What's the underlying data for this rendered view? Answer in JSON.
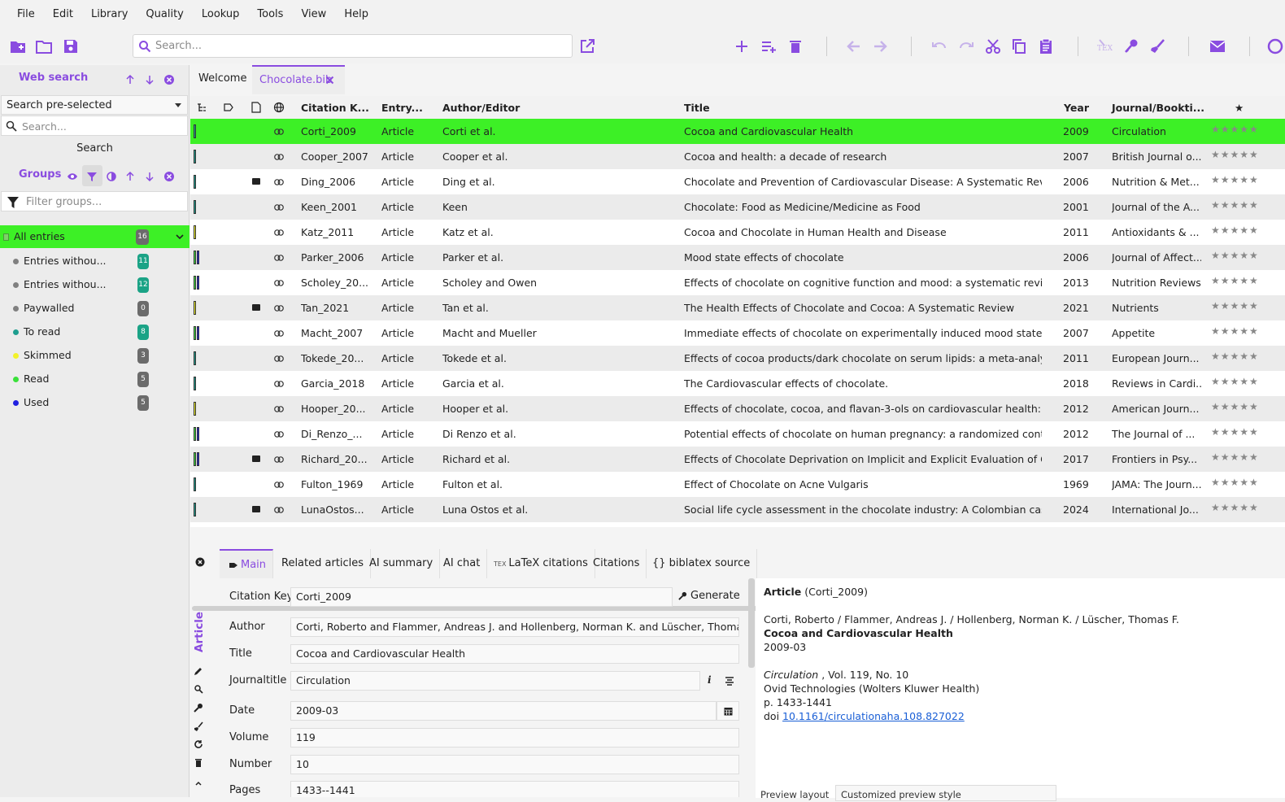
{
  "menu": [
    "File",
    "Edit",
    "Library",
    "Quality",
    "Lookup",
    "Tools",
    "View",
    "Help"
  ],
  "toolbar": {
    "search_placeholder": "Search...",
    "icons": [
      "new-library-icon",
      "open-library-icon",
      "save-icon",
      "open-external-icon",
      "add-entry-icon",
      "add-list-icon",
      "delete-icon",
      "back-icon",
      "forward-icon",
      "undo-icon",
      "redo-icon",
      "cut-icon",
      "copy-icon",
      "paste-icon",
      "tex-icon",
      "lookup-key-icon",
      "cleanup-icon",
      "email-icon"
    ]
  },
  "sidebar": {
    "web_search_title": "Web search",
    "web_search_combo": "Search pre-selected",
    "web_search_placeholder": "Search...",
    "search_button": "Search",
    "groups_title": "Groups",
    "filter_placeholder": "Filter groups...",
    "groups": [
      {
        "label": "All entries",
        "count": "16",
        "color": "#888888"
      },
      {
        "label": "Entries withou...",
        "count": "11",
        "color": "#808080"
      },
      {
        "label": "Entries withou...",
        "count": "12",
        "color": "#808080"
      },
      {
        "label": "Paywalled",
        "count": "0",
        "color": "#808080"
      },
      {
        "label": "To read",
        "count": "8",
        "color": "#1e9e8f"
      },
      {
        "label": "Skimmed",
        "count": "3",
        "color": "#f2f22a"
      },
      {
        "label": "Read",
        "count": "5",
        "color": "#3ae03a"
      },
      {
        "label": "Used",
        "count": "5",
        "color": "#2020e0"
      }
    ]
  },
  "tabs": {
    "welcome": "Welcome",
    "library": "Chocolate.bib"
  },
  "table": {
    "headers": {
      "key": "Citation K...",
      "type": "Entry...",
      "author": "Author/Editor",
      "title": "Title",
      "year": "Year",
      "journal": "Journal/Bookti...",
      "star": "★"
    },
    "stars": "★★★★★",
    "rows": [
      {
        "key": "Corti_2009",
        "type": "Article",
        "author": "Corti et al.",
        "title": "Cocoa and Cardiovascular Health",
        "year": "2009",
        "journal": "Circulation",
        "pdf": false,
        "bars": [
          "#1e9e8f"
        ]
      },
      {
        "key": "Cooper_2007",
        "type": "Article",
        "author": "Cooper et al.",
        "title": "Cocoa and health: a decade of research",
        "year": "2007",
        "journal": "British Journal o...",
        "pdf": false,
        "bars": [
          "#1e9e8f"
        ]
      },
      {
        "key": "Ding_2006",
        "type": "Article",
        "author": "Ding et al.",
        "title": "Chocolate and Prevention of Cardiovascular Disease: A Systematic Review",
        "year": "2006",
        "journal": "Nutrition & Met...",
        "pdf": true,
        "bars": [
          "#1e9e8f"
        ]
      },
      {
        "key": "Keen_2001",
        "type": "Article",
        "author": "Keen",
        "title": "Chocolate: Food as Medicine/Medicine as Food",
        "year": "2001",
        "journal": "Journal of the A...",
        "pdf": false,
        "bars": [
          "#1e9e8f"
        ]
      },
      {
        "key": "Katz_2011",
        "type": "Article",
        "author": "Katz et al.",
        "title": "Cocoa and Chocolate in Human Health and Disease",
        "year": "2011",
        "journal": "Antioxidants & ...",
        "pdf": false,
        "bars": [
          "#f2f22a"
        ]
      },
      {
        "key": "Parker_2006",
        "type": "Article",
        "author": "Parker et al.",
        "title": "Mood state effects of chocolate",
        "year": "2006",
        "journal": "Journal of Affect...",
        "pdf": false,
        "bars": [
          "#3ae03a",
          "#2020e0"
        ]
      },
      {
        "key": "Scholey_20...",
        "type": "Article",
        "author": "Scholey and Owen",
        "title": "Effects of chocolate on cognitive function and mood: a systematic review",
        "year": "2013",
        "journal": "Nutrition Reviews",
        "pdf": false,
        "bars": [
          "#3ae03a",
          "#2020e0"
        ]
      },
      {
        "key": "Tan_2021",
        "type": "Article",
        "author": "Tan et al.",
        "title": "The Health Effects of Chocolate and Cocoa: A Systematic Review",
        "year": "2021",
        "journal": "Nutrients",
        "pdf": true,
        "bars": [
          "#f2f22a"
        ]
      },
      {
        "key": "Macht_2007",
        "type": "Article",
        "author": "Macht and Mueller",
        "title": "Immediate effects of chocolate on experimentally induced mood states",
        "year": "2007",
        "journal": "Appetite",
        "pdf": false,
        "bars": [
          "#3ae03a",
          "#2020e0"
        ]
      },
      {
        "key": "Tokede_20...",
        "type": "Article",
        "author": "Tokede et al.",
        "title": "Effects of cocoa products/dark chocolate on serum lipids: a meta-analysis",
        "year": "2011",
        "journal": "European Journ...",
        "pdf": false,
        "bars": [
          "#1e9e8f"
        ]
      },
      {
        "key": "Garcia_2018",
        "type": "Article",
        "author": "Garcia et al.",
        "title": "The Cardiovascular effects of chocolate.",
        "year": "2018",
        "journal": "Reviews in Cardi...",
        "pdf": false,
        "bars": [
          "#1e9e8f"
        ]
      },
      {
        "key": "Hooper_20...",
        "type": "Article",
        "author": "Hooper et al.",
        "title": "Effects of chocolate, cocoa, and flavan-3-ols on cardiovascular health: a syste...",
        "year": "2012",
        "journal": "American Journ...",
        "pdf": false,
        "bars": [
          "#f2f22a"
        ]
      },
      {
        "key": "Di_Renzo_...",
        "type": "Article",
        "author": "Di Renzo et al.",
        "title": "Potential effects of chocolate on human pregnancy: a randomized controlled...",
        "year": "2012",
        "journal": "The Journal of ...",
        "pdf": false,
        "bars": [
          "#3ae03a",
          "#2020e0"
        ]
      },
      {
        "key": "Richard_20...",
        "type": "Article",
        "author": "Richard et al.",
        "title": "Effects of Chocolate Deprivation on Implicit and Explicit Evaluation of Chocol...",
        "year": "2017",
        "journal": "Frontiers in Psy...",
        "pdf": true,
        "bars": [
          "#3ae03a",
          "#2020e0"
        ]
      },
      {
        "key": "Fulton_1969",
        "type": "Article",
        "author": "Fulton et al.",
        "title": "Effect of Chocolate on Acne Vulgaris",
        "year": "1969",
        "journal": "JAMA: The Journ...",
        "pdf": false,
        "bars": [
          "#1e9e8f"
        ]
      },
      {
        "key": "LunaOstos...",
        "type": "Article",
        "author": "Luna Ostos et al.",
        "title": "Social life cycle assessment in the chocolate industry: A Colombian case stud...",
        "year": "2024",
        "journal": "International Jo...",
        "pdf": true,
        "bars": [
          "#1e9e8f"
        ]
      }
    ]
  },
  "editor": {
    "tabs": [
      "Main",
      "Related articles",
      "AI summary",
      "AI chat",
      "LaTeX citations",
      "Citations",
      "{} biblatex source"
    ],
    "entry_type": "Article",
    "generate": "Generate",
    "fields": [
      {
        "label": "Citation Key",
        "value": "Corti_2009"
      },
      {
        "label": "Author",
        "value": "Corti, Roberto and Flammer, Andreas J. and Hollenberg, Norman K. and Lüscher, Thomas F."
      },
      {
        "label": "Title",
        "value": "Cocoa and Cardiovascular Health"
      },
      {
        "label": "Journaltitle",
        "value": "Circulation"
      },
      {
        "label": "Date",
        "value": "2009-03"
      },
      {
        "label": "Volume",
        "value": "119"
      },
      {
        "label": "Number",
        "value": "10"
      },
      {
        "label": "Pages",
        "value": "1433--1441"
      }
    ]
  },
  "preview": {
    "type": "Article",
    "key_paren": "(Corti_2009)",
    "authors": "Corti, Roberto / Flammer, Andreas J. / Hollenberg, Norman K. / Lüscher, Thomas F.",
    "title": "Cocoa and Cardiovascular Health",
    "date": "2009-03",
    "journal": "Circulation",
    "vol": " , Vol. 119, No. 10",
    "publisher": "Ovid Technologies (Wolters Kluwer Health)",
    "pages": "p. 1433-1441",
    "doi_label": "doi ",
    "doi": "10.1161/circulationaha.108.827022",
    "bottom_label": "Preview layout",
    "bottom_value": "Customized preview style"
  },
  "colors": {
    "accent": "#8a4ce0",
    "selected_row": "#3df026",
    "count_badge": "#1ba386",
    "count_gray": "#6b6b6b"
  }
}
